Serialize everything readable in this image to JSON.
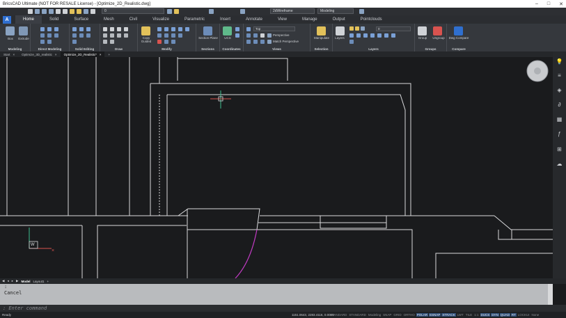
{
  "app": {
    "title": "BricsCAD Ultimate (NOT FOR RESALE License) - [Optimize_2D_Realistic.dwg]",
    "window_controls": [
      "–",
      "□",
      "✕"
    ]
  },
  "quick_access": {
    "layer_value": "0",
    "visual_style": "2dWireframe",
    "workspace": "Modeling"
  },
  "ribbon_tabs": [
    "Home",
    "Solid",
    "Surface",
    "Mesh",
    "Civil",
    "Visualize",
    "Parametric",
    "Insert",
    "Annotate",
    "View",
    "Manage",
    "Output",
    "Pointclouds"
  ],
  "ribbon_active_tab": "Home",
  "ribbon_groups": {
    "modeling": {
      "label": "Modeling",
      "box": "Box",
      "extrude": "Extrude"
    },
    "direct_modeling": {
      "label": "Direct Modeling"
    },
    "solid_editing": {
      "label": "Solid Editing"
    },
    "draw": {
      "label": "Draw"
    },
    "modify": {
      "label": "Modify",
      "copy_guided": "Copy Guided"
    },
    "sections": {
      "label": "Sections",
      "section_plane": "Section Plane"
    },
    "coordinates": {
      "label": "Coordinates",
      "ucs": "UCS"
    },
    "views": {
      "label": "Views",
      "view_dropdown": "Top",
      "perspective": "Perspective",
      "match_perspective": "Match Perspective"
    },
    "selection": {
      "label": "Selection",
      "manipulate": "Manipulate"
    },
    "layers": {
      "label": "Layers",
      "layers_btn": "Layers",
      "layer_dropdown": "0"
    },
    "groups": {
      "label": "Groups",
      "group": "Group",
      "ungroup": "Ungroup"
    },
    "compare": {
      "label": "Compare",
      "dwg_compare": "Dwg Compare"
    }
  },
  "document_tabs": [
    {
      "label": "Start",
      "close": "×"
    },
    {
      "label": "Optimize_3D_realistic",
      "close": "×"
    },
    {
      "label": "Optimize_2D_Realistic*",
      "close": "×"
    }
  ],
  "document_tab_add": "+",
  "ucs_icon": {
    "label": "W"
  },
  "layout_tabs": {
    "model": "Model",
    "layout1": "Layout1",
    "add": "+"
  },
  "command_history": [
    ":",
    "Cancel"
  ],
  "command_prompt": ": Enter command",
  "status": {
    "ready": "Ready",
    "coordinates": "1151.0643, 2283.4116, 0.0000",
    "toggles": [
      {
        "label": "STANDARD",
        "on": false
      },
      {
        "label": "STANDARD",
        "on": false
      },
      {
        "label": "Modeling",
        "on": false
      },
      {
        "label": "SNAP",
        "on": false
      },
      {
        "label": "GRID",
        "on": false
      },
      {
        "label": "ORTHO",
        "on": false
      },
      {
        "label": "POLAR",
        "on": true
      },
      {
        "label": "ESNAP",
        "on": true
      },
      {
        "label": "STRACK",
        "on": true
      },
      {
        "label": "LWT",
        "on": false
      },
      {
        "label": "TILE",
        "on": false
      },
      {
        "label": "1:1",
        "on": false
      },
      {
        "label": "DUCS",
        "on": true
      },
      {
        "label": "DYN",
        "on": true
      },
      {
        "label": "QUAD",
        "on": true
      },
      {
        "label": "RT",
        "on": true
      },
      {
        "label": "LOCKUI",
        "on": false
      },
      {
        "label": "None",
        "on": false
      }
    ]
  },
  "colors": {
    "viewport_bg": "#1a1b1d",
    "line_white": "#d9dadc",
    "arc_magenta": "#c23bc4",
    "crosshair_green": "#3fbf8f",
    "crosshair_red": "#d9534f",
    "accent_blue": "#2f6fcf"
  }
}
